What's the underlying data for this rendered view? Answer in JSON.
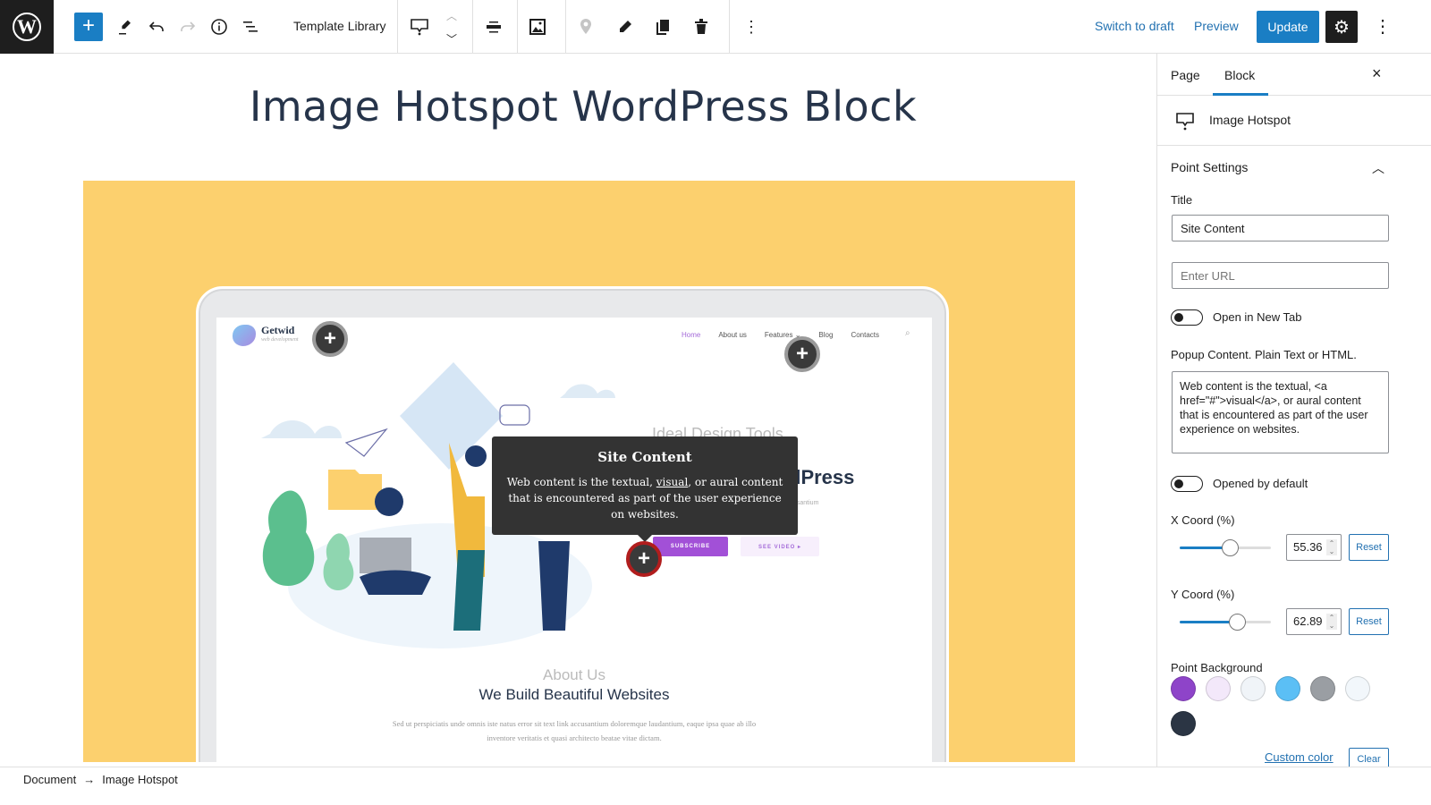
{
  "toolbar": {
    "template_library": "Template Library",
    "switch_to_draft": "Switch to draft",
    "preview": "Preview",
    "update": "Update",
    "icons": [
      "wordpress-logo",
      "add-block",
      "edit-tools",
      "undo",
      "redo",
      "details-info",
      "list-view",
      "image-hotspot-block",
      "move-up",
      "move-down",
      "align",
      "replace-image",
      "add-point",
      "edit-point",
      "duplicate-point",
      "delete-point",
      "more-options",
      "settings",
      "options"
    ]
  },
  "editor": {
    "post_title": "Image Hotspot WordPress Block",
    "site": {
      "brand": "Getwid",
      "tagline": "web development",
      "nav": [
        "Home",
        "About us",
        "Features ⌄",
        "Blog",
        "Contacts"
      ],
      "ideal": "Ideal Design Tools",
      "heading": "dPress",
      "accus": "usantium",
      "subscribe": "SUBSCRIBE",
      "see_video": "SEE VIDEO ▸",
      "about_sub": "About Us",
      "about_head": "We Build Beautiful Websites",
      "about_p": "Sed ut perspiciatis unde omnis iste natus error sit text link accusantium doloremque laudantium, eaque ipsa quae ab illo inventore veritatis et quasi architecto beatae vitae dictam."
    },
    "popup": {
      "title": "Site Content",
      "body_before": "Web content is the textual, ",
      "body_link": "visual",
      "body_after": ", or aural content that is encountered as part of the user experience on websites."
    },
    "hotspots": [
      {
        "label": "+",
        "x_pct": 12.4,
        "y_pct": 8.6,
        "active": false
      },
      {
        "label": "+",
        "x_pct": 80.3,
        "y_pct": 11.2,
        "active": false
      },
      {
        "label": "+",
        "x_pct": 55.36,
        "y_pct": 62.89,
        "active": true
      }
    ]
  },
  "sidebar": {
    "tabs": [
      {
        "label": "Page"
      },
      {
        "label": "Block",
        "active": true
      }
    ],
    "close": "×",
    "block_name": "Image Hotspot",
    "panel_title": "Point Settings",
    "title_label": "Title",
    "title_value": "Site Content",
    "url_placeholder": "Enter URL",
    "open_new_tab": "Open in New Tab",
    "open_new_tab_on": false,
    "popup_label": "Popup Content. Plain Text or HTML.",
    "popup_value": "Web content is the textual, <a href=\"#\">visual</a>, or aural content that is encountered as part of the user experience on websites.",
    "opened_default": "Opened by default",
    "opened_default_on": false,
    "x_label": "X Coord (%)",
    "x_value": "55.36",
    "x_display": "55.3̶",
    "y_label": "Y Coord (%)",
    "y_value": "62.89",
    "reset": "Reset",
    "bg_label": "Point Background",
    "swatches": [
      "#8e44c9",
      "#f3e8fa",
      "#f0f4f8",
      "#5bbff5",
      "#9a9ea3",
      "#f2f7fb",
      "#2b3544"
    ],
    "custom_color": "Custom color",
    "clear": "Clear"
  },
  "footer": {
    "crumbs": [
      "Document",
      "Image Hotspot"
    ],
    "arrow": "→"
  }
}
